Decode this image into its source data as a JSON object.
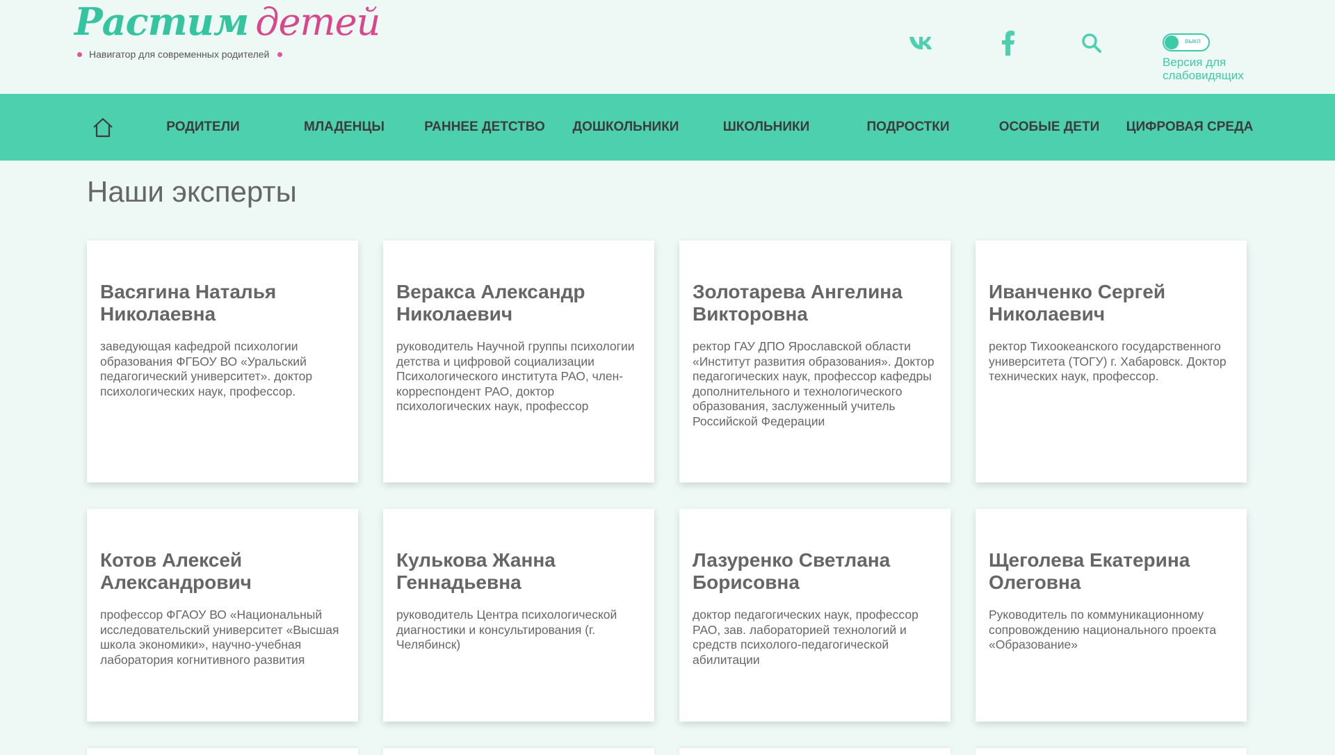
{
  "logo": {
    "title_part1": "Растим",
    "title_part2": "детей",
    "subtitle": "Навигатор для современных родителей"
  },
  "header": {
    "icons": [
      "vk-icon",
      "facebook-icon",
      "search-icon"
    ],
    "accessibility": {
      "toggle_label": "выкл",
      "text": "Версия для слабовидящих"
    }
  },
  "nav": {
    "items": [
      {
        "label": "РОДИТЕЛИ"
      },
      {
        "label": "МЛАДЕНЦЫ"
      },
      {
        "label": "РАННЕЕ ДЕТСТВО"
      },
      {
        "label": "ДОШКОЛЬНИКИ"
      },
      {
        "label": "ШКОЛЬНИКИ"
      },
      {
        "label": "ПОДРОСТКИ"
      },
      {
        "label": "ОСОБЫЕ ДЕТИ"
      },
      {
        "label": "ЦИФРОВАЯ СРЕДА"
      }
    ]
  },
  "main": {
    "title": "Наши эксперты",
    "experts": [
      {
        "name": "Васягина Наталья Николаевна",
        "desc": "заведующая кафедрой психологии образования ФГБОУ ВО «Уральский педагогический университет». доктор психологических наук, профессор."
      },
      {
        "name": "Веракса Александр Николаевич",
        "desc": "руководитель Научной группы психологии детства и цифровой социализации Психологического института РАО, член-корреспондент РАО, доктор психологических наук, профессор"
      },
      {
        "name": "Золотарева Ангелина Викторовна",
        "desc": "ректор ГАУ ДПО Ярославской области «Институт развития образования». Доктор педагогических наук, профессор кафедры дополнительного и технологического образования, заслуженный учитель Российской Федерации"
      },
      {
        "name": "Иванченко Сергей Николаевич",
        "desc": "ректор Тихоокеанского государственного университета (ТОГУ) г. Хабаровск. Доктор технических наук, профессор."
      },
      {
        "name": "Котов Алексей Александрович",
        "desc": "профессор ФГАОУ ВО «Национальный исследовательский университет «Высшая школа экономики», научно-учебная лаборатория когнитивного развития"
      },
      {
        "name": "Кулькова Жанна Геннадьевна",
        "desc": "руководитель Центра психологической диагностики и консультирования (г. Челябинск)"
      },
      {
        "name": "Лазуренко Светлана Борисовна",
        "desc": "доктор педагогических наук, профессор РАО, зав. лабораторией технологий и средств психолого-педагогической абилитации"
      },
      {
        "name": "Щеголева Екатерина Олеговна",
        "desc": "Руководитель по коммуникационному сопровождению национального проекта «Образование»"
      }
    ]
  },
  "colors": {
    "accent": "#4dd0ae",
    "brand_pink": "#d9468a",
    "background": "#eef9f6"
  }
}
